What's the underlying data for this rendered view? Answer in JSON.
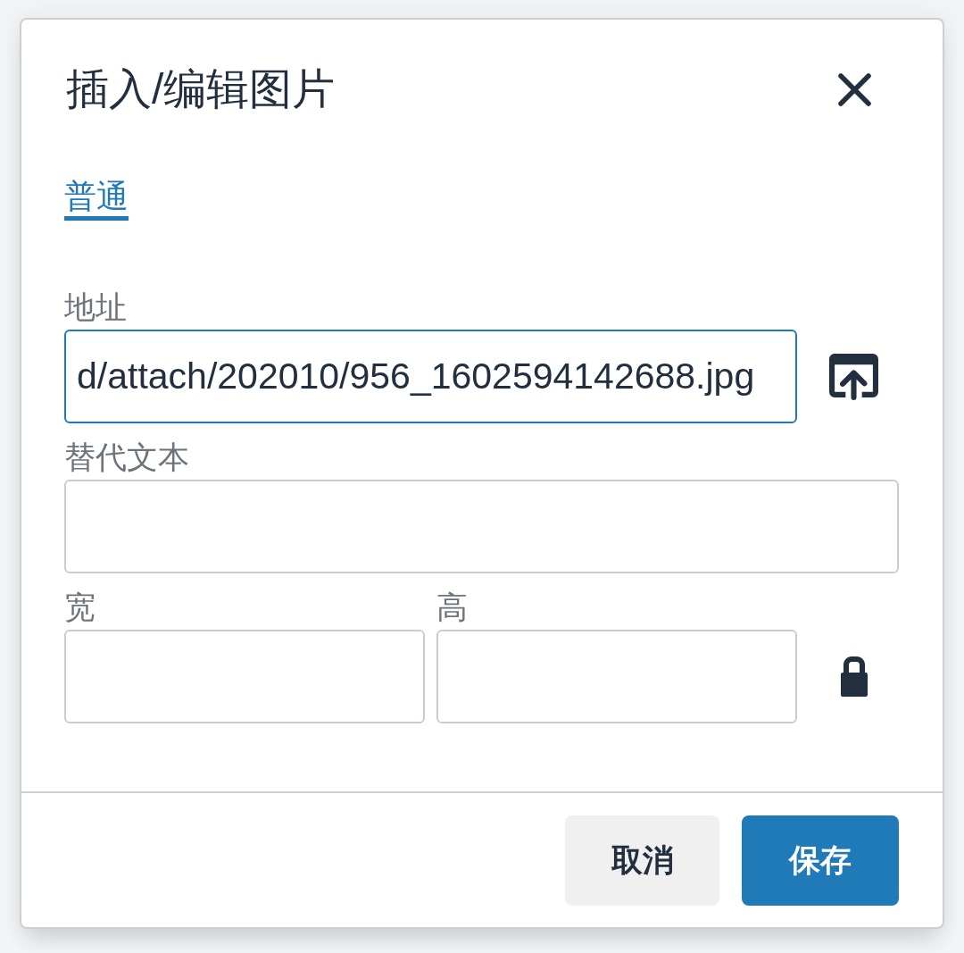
{
  "dialog": {
    "title": "插入/编辑图片",
    "tabs": [
      {
        "label": "普通",
        "selected": true
      }
    ],
    "source": {
      "label": "地址",
      "value": "d/attach/202010/956_1602594142688.jpg",
      "focused": true
    },
    "alt": {
      "label": "替代文本",
      "focused": false
    },
    "dimensions": {
      "width": {
        "label": "宽",
        "focused": false
      },
      "height": {
        "label": "高",
        "focused": false
      },
      "locked": true
    },
    "buttons": [
      {
        "label": "取消",
        "kind": "secondary"
      },
      {
        "label": "保存",
        "kind": "primary"
      }
    ]
  }
}
